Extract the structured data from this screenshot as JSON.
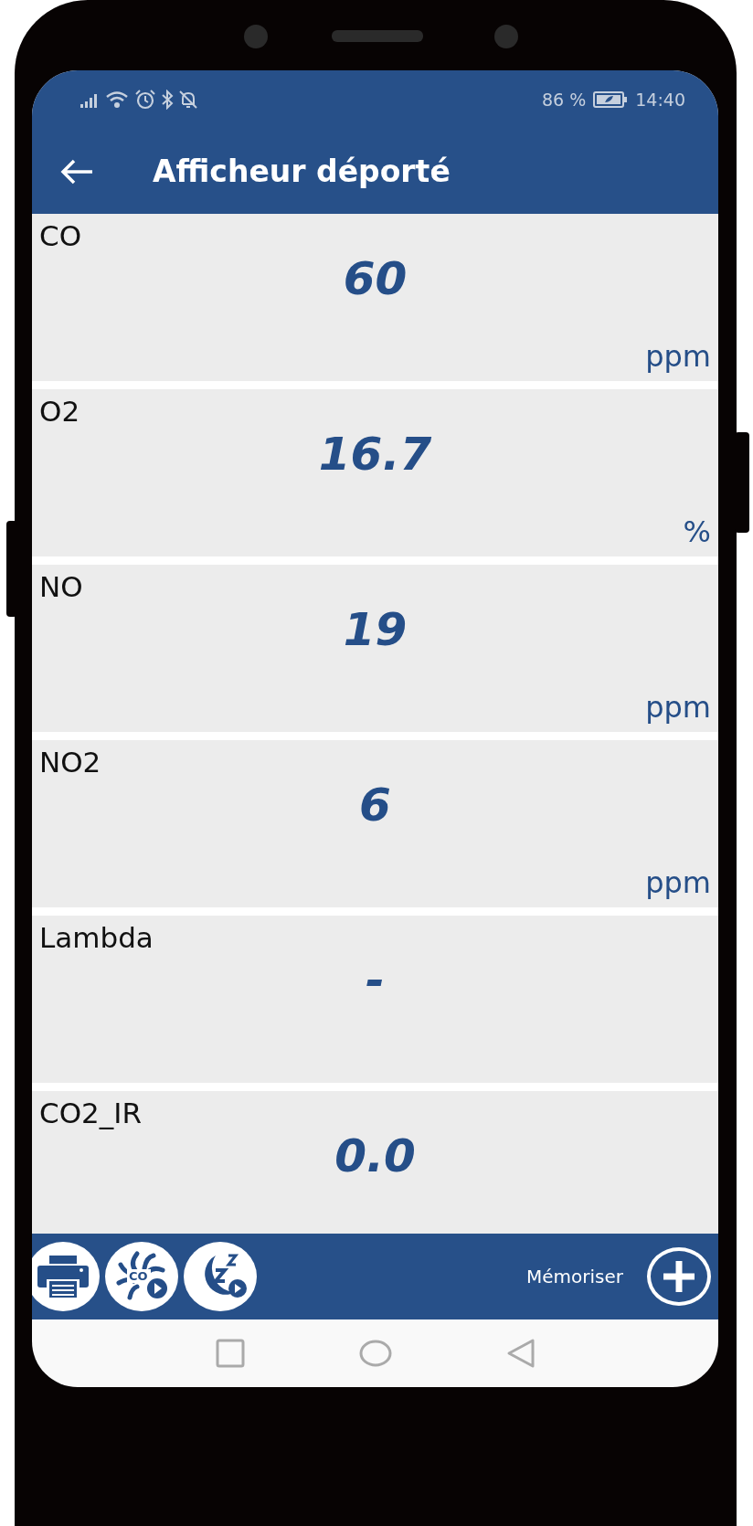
{
  "status_bar": {
    "battery_text": "86 %",
    "time": "14:40"
  },
  "app_bar": {
    "title": "Afficheur déporté"
  },
  "measurements": [
    {
      "label": "CO",
      "value": "60",
      "unit": "ppm"
    },
    {
      "label": "O2",
      "value": "16.7",
      "unit": "%"
    },
    {
      "label": "NO",
      "value": "19",
      "unit": "ppm"
    },
    {
      "label": "NO2",
      "value": "6",
      "unit": "ppm"
    },
    {
      "label": "Lambda",
      "value": "-"
    },
    {
      "label": "CO2_IR",
      "value": "0.0"
    }
  ],
  "toolbar": {
    "co_button_label": "CO",
    "memorize_label": "Mémoriser"
  }
}
